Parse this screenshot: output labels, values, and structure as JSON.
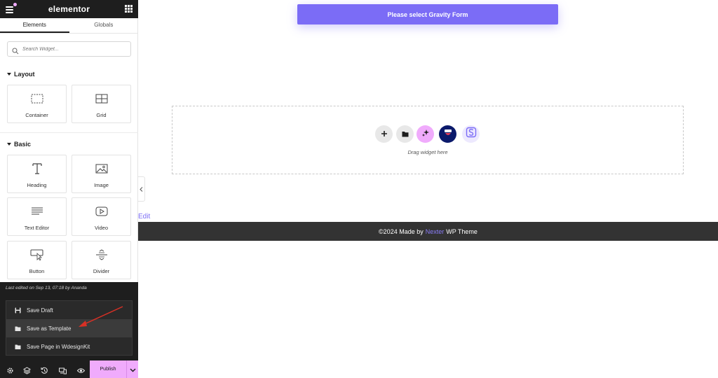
{
  "sidebar": {
    "logo": "elementor",
    "tabs": [
      "Elements",
      "Globals"
    ],
    "search_placeholder": "Search Widget...",
    "categories": {
      "layout": "Layout",
      "basic": "Basic"
    },
    "layout_widgets": [
      {
        "label": "Container",
        "icon": "container-icon"
      },
      {
        "label": "Grid",
        "icon": "grid-icon"
      }
    ],
    "basic_widgets": [
      {
        "label": "Heading",
        "icon": "heading-icon"
      },
      {
        "label": "Image",
        "icon": "image-icon"
      },
      {
        "label": "Text Editor",
        "icon": "text-editor-icon"
      },
      {
        "label": "Video",
        "icon": "video-icon"
      },
      {
        "label": "Button",
        "icon": "button-icon"
      },
      {
        "label": "Divider",
        "icon": "divider-icon"
      }
    ],
    "last_edited": "Last edited on Sep 13, 07:18 by Ananda",
    "save_menu": [
      {
        "label": "Save Draft",
        "icon": "save-icon"
      },
      {
        "label": "Save as Template",
        "icon": "folder-icon"
      },
      {
        "label": "Save Page in WdesignKit",
        "icon": "folder-icon"
      }
    ],
    "publish_label": "Publish"
  },
  "canvas": {
    "gravity_form_button": "Please select Gravity Form",
    "drag_text": "Drag widget here",
    "edit_link": "Edit",
    "footer": {
      "prefix": "©2024 Made by",
      "brand": "Nexter",
      "suffix": "WP Theme"
    }
  },
  "colors": {
    "accent": "#7b6cf6",
    "publish": "#f0abfc",
    "dark_panel": "#1e1e1e",
    "footer_bg": "#333333",
    "arrow": "#d93025"
  }
}
